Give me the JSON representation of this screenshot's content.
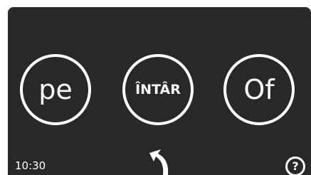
{
  "screen": {
    "background_color": "#282828",
    "foreground_color": "#ffffff"
  },
  "choices": [
    {
      "label": "pe"
    },
    {
      "label": "ÎNTÂR"
    },
    {
      "label": "Of"
    }
  ],
  "status": {
    "time": "10:30"
  },
  "controls": {
    "back_icon": "back-arrow-icon",
    "help_icon": "help-icon",
    "help_glyph": "?"
  }
}
